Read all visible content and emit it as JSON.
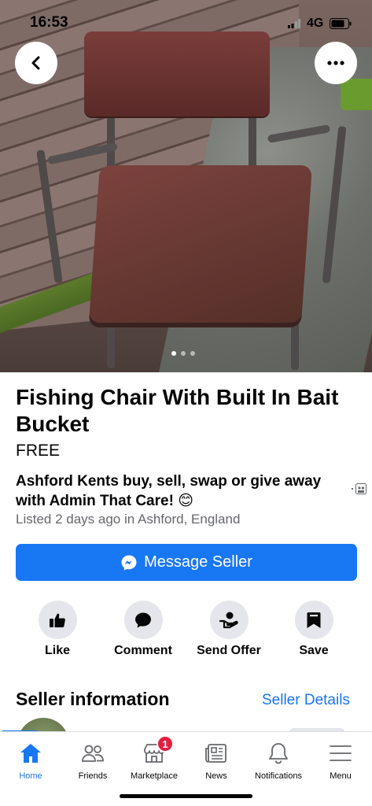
{
  "status_bar": {
    "time": "16:53",
    "network": "4G"
  },
  "photo": {
    "alt": "Fishing chair",
    "pager_count": 3,
    "pager_active": 1
  },
  "listing": {
    "title": "Fishing Chair With Built In Bait Bucket",
    "price": "FREE",
    "group_name": "Ashford Kents buy, sell, swap or give away with Admin That Care! 😊",
    "listed_info": "Listed 2 days ago in Ashford, England",
    "message_button": "Message Seller"
  },
  "actions": [
    {
      "label": "Like",
      "icon": "thumbs-up-icon"
    },
    {
      "label": "Comment",
      "icon": "comment-icon"
    },
    {
      "label": "Send Offer",
      "icon": "send-offer-icon"
    },
    {
      "label": "Save",
      "icon": "bookmark-icon"
    }
  ],
  "seller": {
    "heading": "Seller information",
    "details_link": "Seller Details"
  },
  "tabbar": {
    "tabs": [
      {
        "label": "Home",
        "icon": "home-icon",
        "active": true
      },
      {
        "label": "Friends",
        "icon": "friends-icon"
      },
      {
        "label": "Marketplace",
        "icon": "marketplace-icon",
        "badge": "1"
      },
      {
        "label": "News",
        "icon": "news-icon"
      },
      {
        "label": "Notifications",
        "icon": "bell-icon"
      },
      {
        "label": "Menu",
        "icon": "menu-icon"
      }
    ]
  },
  "colors": {
    "accent": "#1877f2",
    "badge": "#e41e3f",
    "secondary_text": "#65676b",
    "button_bg": "#e4e6eb"
  }
}
